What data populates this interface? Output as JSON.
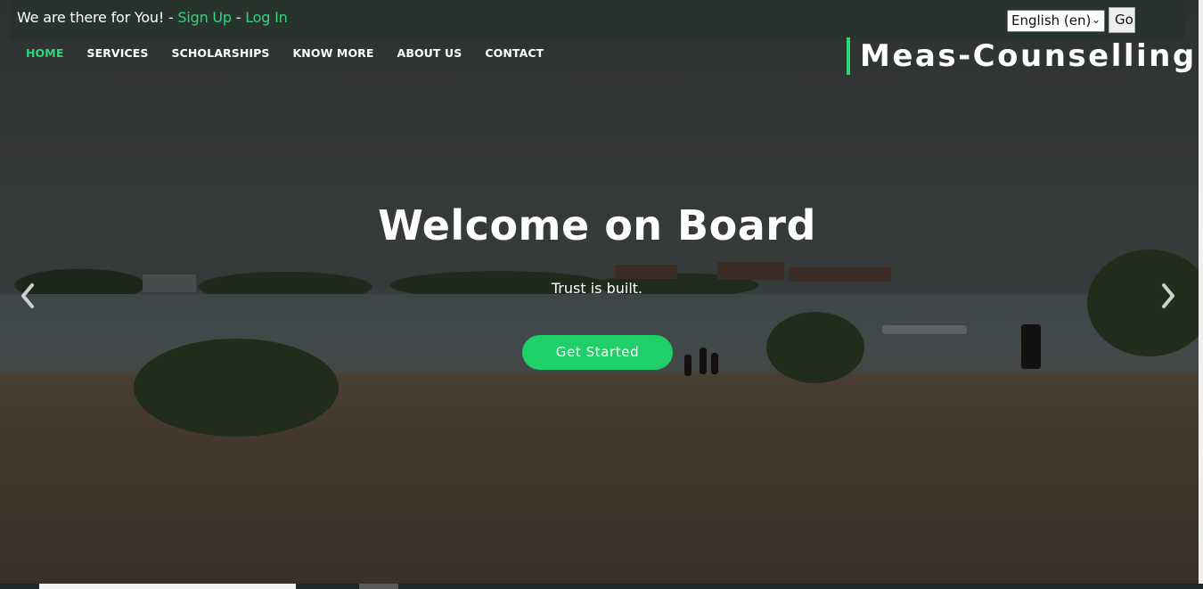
{
  "topbar": {
    "welcome_text": "We are there for You! - ",
    "sign_up": "Sign Up",
    "separator": " - ",
    "log_in": "Log In",
    "language_selected": "English (en)",
    "go_label": "Go"
  },
  "nav": {
    "items": [
      {
        "label": "HOME",
        "active": true
      },
      {
        "label": "SERVICES",
        "active": false
      },
      {
        "label": "SCHOLARSHIPS",
        "active": false
      },
      {
        "label": "KNOW MORE",
        "active": false
      },
      {
        "label": "ABOUT US",
        "active": false
      },
      {
        "label": "CONTACT",
        "active": false
      }
    ]
  },
  "brand": {
    "name": "Meas-Counselling"
  },
  "hero": {
    "title": "Welcome on Board",
    "subtitle": "Trust is built.",
    "cta_label": "Get Started"
  },
  "icons": {
    "prev": "chevron-left-icon",
    "next": "chevron-right-icon",
    "select_arrow": "chevron-down-icon"
  },
  "colors": {
    "accent": "#2ed77a",
    "cta": "#1fcf68",
    "topbar_bg": "#29332e"
  }
}
